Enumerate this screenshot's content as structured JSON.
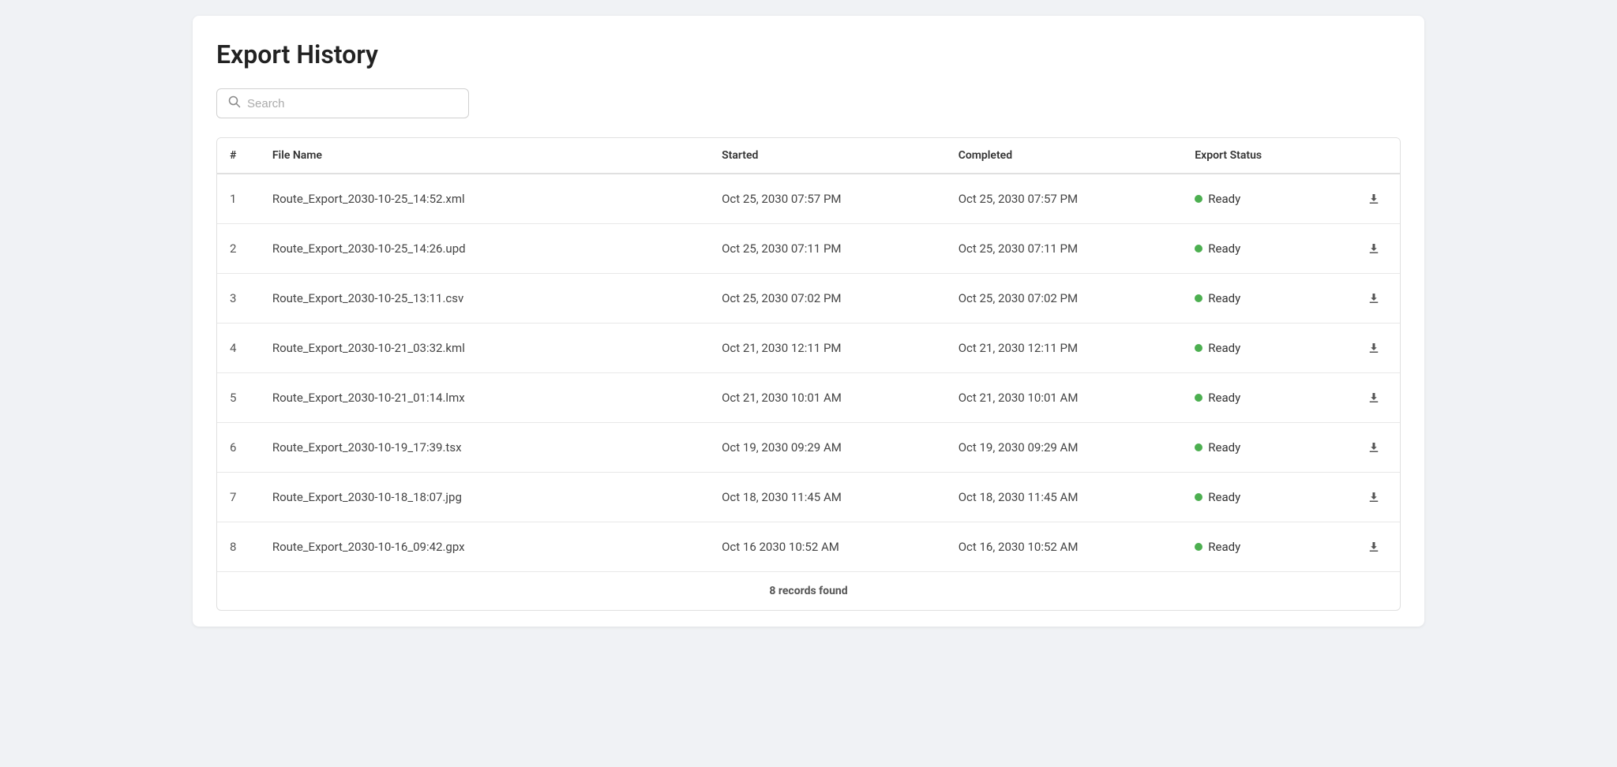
{
  "page": {
    "title": "Export History"
  },
  "search": {
    "placeholder": "Search",
    "value": ""
  },
  "table": {
    "columns": [
      {
        "key": "num",
        "label": "#"
      },
      {
        "key": "filename",
        "label": "File Name"
      },
      {
        "key": "started",
        "label": "Started"
      },
      {
        "key": "completed",
        "label": "Completed"
      },
      {
        "key": "status",
        "label": "Export Status"
      },
      {
        "key": "download",
        "label": ""
      }
    ],
    "rows": [
      {
        "num": 1,
        "filename": "Route_Export_2030-10-25_14:52.xml",
        "started": "Oct 25, 2030 07:57 PM",
        "completed": "Oct 25, 2030 07:57 PM",
        "status": "Ready"
      },
      {
        "num": 2,
        "filename": "Route_Export_2030-10-25_14:26.upd",
        "started": "Oct 25, 2030 07:11 PM",
        "completed": "Oct 25, 2030 07:11 PM",
        "status": "Ready"
      },
      {
        "num": 3,
        "filename": "Route_Export_2030-10-25_13:11.csv",
        "started": "Oct 25, 2030 07:02 PM",
        "completed": "Oct 25, 2030 07:02 PM",
        "status": "Ready"
      },
      {
        "num": 4,
        "filename": "Route_Export_2030-10-21_03:32.kml",
        "started": "Oct 21, 2030 12:11 PM",
        "completed": "Oct 21, 2030 12:11 PM",
        "status": "Ready"
      },
      {
        "num": 5,
        "filename": "Route_Export_2030-10-21_01:14.lmx",
        "started": "Oct 21, 2030 10:01 AM",
        "completed": "Oct 21, 2030 10:01 AM",
        "status": "Ready"
      },
      {
        "num": 6,
        "filename": "Route_Export_2030-10-19_17:39.tsx",
        "started": "Oct 19, 2030 09:29 AM",
        "completed": "Oct 19, 2030 09:29 AM",
        "status": "Ready"
      },
      {
        "num": 7,
        "filename": "Route_Export_2030-10-18_18:07.jpg",
        "started": "Oct 18, 2030 11:45 AM",
        "completed": "Oct 18, 2030 11:45 AM",
        "status": "Ready"
      },
      {
        "num": 8,
        "filename": "Route_Export_2030-10-16_09:42.gpx",
        "started": "Oct 16 2030 10:52 AM",
        "completed": "Oct 16, 2030 10:52 AM",
        "status": "Ready"
      }
    ],
    "footer": {
      "records_label": "records found",
      "records_count": "8"
    }
  },
  "colors": {
    "status_ready_dot": "#4caf50",
    "accent": "#4caf50"
  }
}
